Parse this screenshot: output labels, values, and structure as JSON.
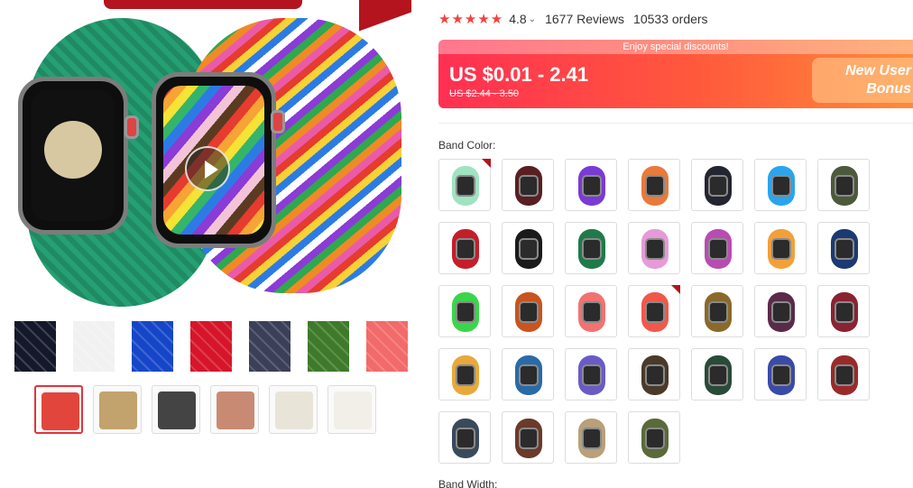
{
  "rating": {
    "stars": "★★★★★",
    "value": "4.8",
    "caret": "⌄",
    "reviews": "1677 Reviews",
    "orders": "10533 orders"
  },
  "price": {
    "discount_banner": "Enjoy special discounts!",
    "current": "US $0.01 - 2.41",
    "original": "US $2.44 - 3.50",
    "bonus": "New User\nBonus",
    "gradient_start": "#ff2f52",
    "gradient_end": "#ff8a3a"
  },
  "labels": {
    "band_color": "Band Color:",
    "band_width": "Band Width:"
  },
  "media": {
    "play_icon": "play-icon"
  },
  "swatch_strip": [
    "#14182a",
    "#f1f1f1",
    "#1646c8",
    "#d6152a",
    "#3b4058",
    "#3e7a2a",
    "#f26a6a"
  ],
  "thumbnails": [
    {
      "name": "thumb-1",
      "color": "#e2453c",
      "active": true
    },
    {
      "name": "thumb-2",
      "color": "#c2a36e",
      "active": false
    },
    {
      "name": "thumb-3",
      "color": "#444444",
      "active": false
    },
    {
      "name": "thumb-4",
      "color": "#c98a74",
      "active": false
    },
    {
      "name": "thumb-5",
      "color": "#e9e4d8",
      "active": false
    },
    {
      "name": "thumb-6",
      "color": "#f2efe8",
      "active": false
    }
  ],
  "band_colors": [
    {
      "color": "#9fe3c0",
      "corner": true
    },
    {
      "color": "#5a1f22",
      "corner": false
    },
    {
      "color": "#7a3ad6",
      "corner": false
    },
    {
      "color": "#e97a3a",
      "corner": false
    },
    {
      "color": "#232530",
      "corner": false
    },
    {
      "color": "#2aa4ef",
      "corner": false
    },
    {
      "color": "#4c5a3a",
      "corner": false
    },
    {
      "color": "#c41e2a",
      "corner": false
    },
    {
      "color": "#1a1a1a",
      "corner": false
    },
    {
      "color": "#1f7a4a",
      "corner": false
    },
    {
      "color": "#e69ad8",
      "corner": false
    },
    {
      "color": "#b94cb2",
      "corner": false
    },
    {
      "color": "#f2a03a",
      "corner": false
    },
    {
      "color": "#1c3a72",
      "corner": false
    },
    {
      "color": "#3ad64a",
      "corner": false
    },
    {
      "color": "#c9541e",
      "corner": false
    },
    {
      "color": "#f27272",
      "corner": false
    },
    {
      "color": "#f2574a",
      "corner": true
    },
    {
      "color": "#8a6a2a",
      "corner": false
    },
    {
      "color": "#5a2a4a",
      "corner": false
    },
    {
      "color": "#8a2232",
      "corner": false
    },
    {
      "color": "#e8a93a",
      "corner": false
    },
    {
      "color": "#2a6aa8",
      "corner": false
    },
    {
      "color": "#6a5ac8",
      "corner": false
    },
    {
      "color": "#4a3a2a",
      "corner": false
    },
    {
      "color": "#2a4a3a",
      "corner": false
    },
    {
      "color": "#3a4aa8",
      "corner": false
    },
    {
      "color": "#9a2a2a",
      "corner": false
    },
    {
      "color": "#3a4a5a",
      "corner": false
    },
    {
      "color": "#6a3a2a",
      "corner": false
    },
    {
      "color": "#b8a07a",
      "corner": false
    },
    {
      "color": "#5a6a3a",
      "corner": false
    }
  ]
}
